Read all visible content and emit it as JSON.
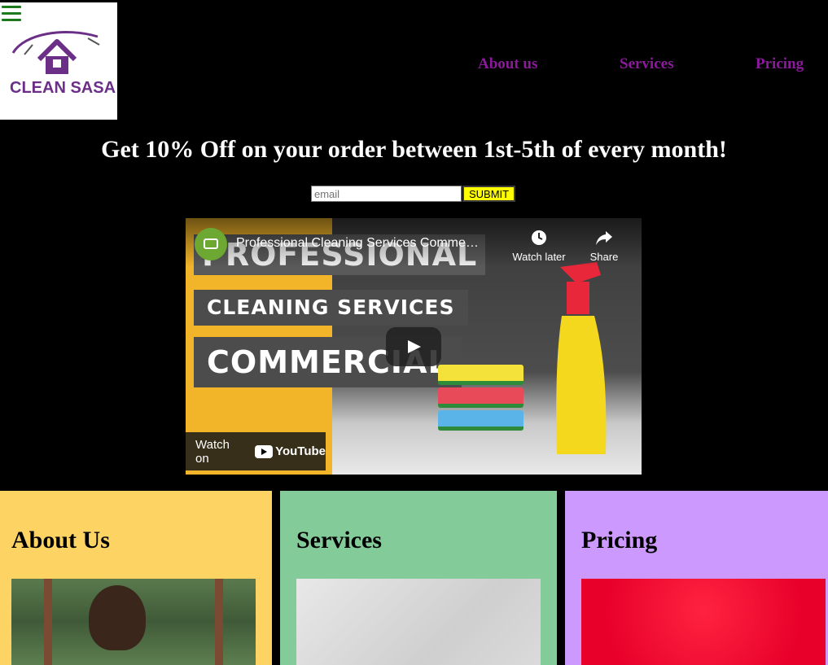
{
  "header": {
    "logo_text": "CLEAN SASA",
    "nav": [
      "About us",
      "Services",
      "Pricing"
    ]
  },
  "promo": {
    "headline": "Get 10% Off on your order between 1st-5th of every month!",
    "email_placeholder": "email",
    "submit_label": "SUBMIT"
  },
  "video": {
    "title": "Professional Cleaning Services Comme…",
    "watch_later": "Watch later",
    "share": "Share",
    "thumb_words": [
      "PROFESSIONAL",
      "CLEANING SERVICES",
      "COMMERCIAL"
    ],
    "watch_on": "Watch on",
    "youtube": "YouTube"
  },
  "cards": [
    {
      "title": "About Us",
      "color": "#fdd463"
    },
    {
      "title": "Services",
      "color": "#83cc9a"
    },
    {
      "title": "Pricing",
      "color": "#cc99ff"
    }
  ],
  "colors": {
    "accent": "#8b1a9b",
    "submit": "#ffff00",
    "menu": "#1b7a1b"
  }
}
